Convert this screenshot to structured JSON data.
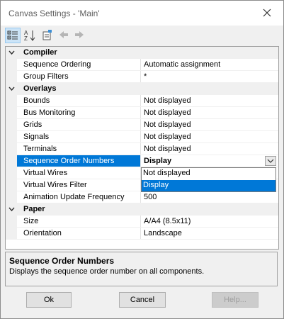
{
  "window": {
    "title": "Canvas Settings - 'Main'"
  },
  "toolbar": {
    "buttons": [
      {
        "name": "categorized",
        "icon": "categorized-view-icon"
      },
      {
        "name": "alphabetical",
        "icon": "sort-az-icon"
      },
      {
        "name": "property-pages",
        "icon": "property-pages-icon"
      },
      {
        "name": "back",
        "icon": "arrow-back-icon"
      },
      {
        "name": "forward",
        "icon": "arrow-forward-icon"
      }
    ]
  },
  "grid": {
    "compiler": {
      "label": "Compiler",
      "seq_ordering": {
        "name": "Sequence Ordering",
        "value": "Automatic assignment"
      },
      "group_filters": {
        "name": "Group Filters",
        "value": "*"
      }
    },
    "overlays": {
      "label": "Overlays",
      "bounds": {
        "name": "Bounds",
        "value": "Not displayed"
      },
      "bus_monitoring": {
        "name": "Bus Monitoring",
        "value": "Not displayed"
      },
      "grids": {
        "name": "Grids",
        "value": "Not displayed"
      },
      "signals": {
        "name": "Signals",
        "value": "Not displayed"
      },
      "terminals": {
        "name": "Terminals",
        "value": "Not displayed"
      },
      "seq_order_numbers": {
        "name": "Sequence Order Numbers",
        "value": "Display"
      },
      "virtual_wires": {
        "name": "Virtual Wires"
      },
      "virtual_wires_filter": {
        "name": "Virtual Wires Filter"
      },
      "anim_update_freq": {
        "name": "Animation Update Frequency",
        "value": "500"
      }
    },
    "paper": {
      "label": "Paper",
      "size": {
        "name": "Size",
        "value": "A/A4 (8.5x11)"
      },
      "orientation": {
        "name": "Orientation",
        "value": "Landscape"
      }
    }
  },
  "dropdown": {
    "options": [
      "Not displayed",
      "Display"
    ],
    "selected": "Display"
  },
  "help": {
    "title": "Sequence Order Numbers",
    "description": "Displays the sequence order number on all components."
  },
  "buttons": {
    "ok": "Ok",
    "cancel": "Cancel",
    "help": "Help..."
  }
}
